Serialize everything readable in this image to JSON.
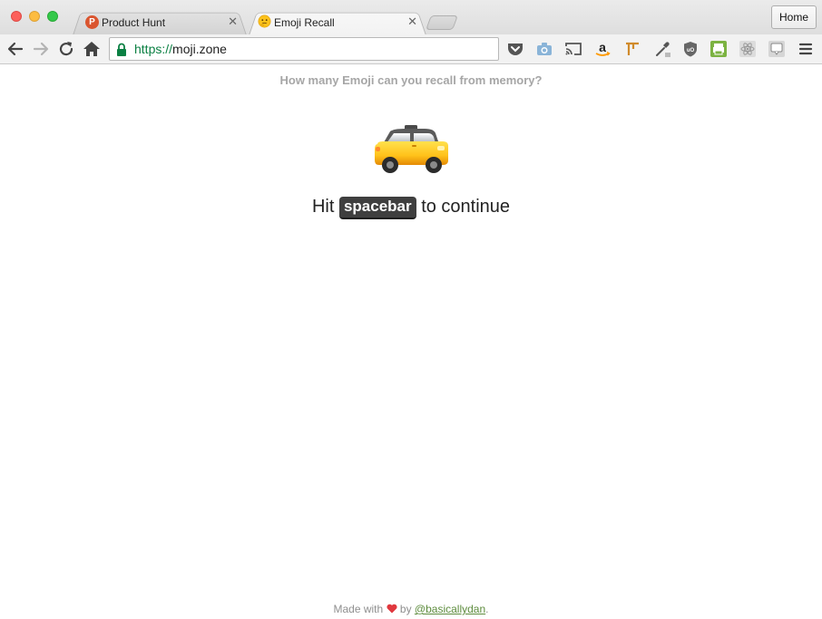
{
  "browser": {
    "tabs": [
      {
        "title": "Product Hunt",
        "favicon": "P",
        "favicon_color": "#da552f",
        "active": false
      },
      {
        "title": "Emoji Recall",
        "favicon": "thinking-face-emoji",
        "active": true
      }
    ],
    "home_button_label": "Home",
    "url": {
      "scheme": "https://",
      "host": "moji.zone"
    },
    "extensions": [
      "pocket-icon",
      "camera-icon",
      "cast-icon",
      "amazon-icon",
      "measure-icon",
      "eyedropper-icon",
      "ublock-icon",
      "print-icon",
      "react-devtools-icon",
      "chat-icon"
    ]
  },
  "page": {
    "tagline": "How many Emoji can you recall from memory?",
    "instruction_prefix": "Hit",
    "key_label": "spacebar",
    "instruction_suffix": "to continue",
    "emoji": "taxi-car",
    "footer": {
      "made_with": "Made with",
      "by": "by",
      "author": "@basicallydan",
      "end": "."
    }
  },
  "colors": {
    "tagline": "#a6a6a6",
    "key_bg": "#3f3f3f",
    "link": "#5d8c3d",
    "secure_url": "#0b8043"
  }
}
